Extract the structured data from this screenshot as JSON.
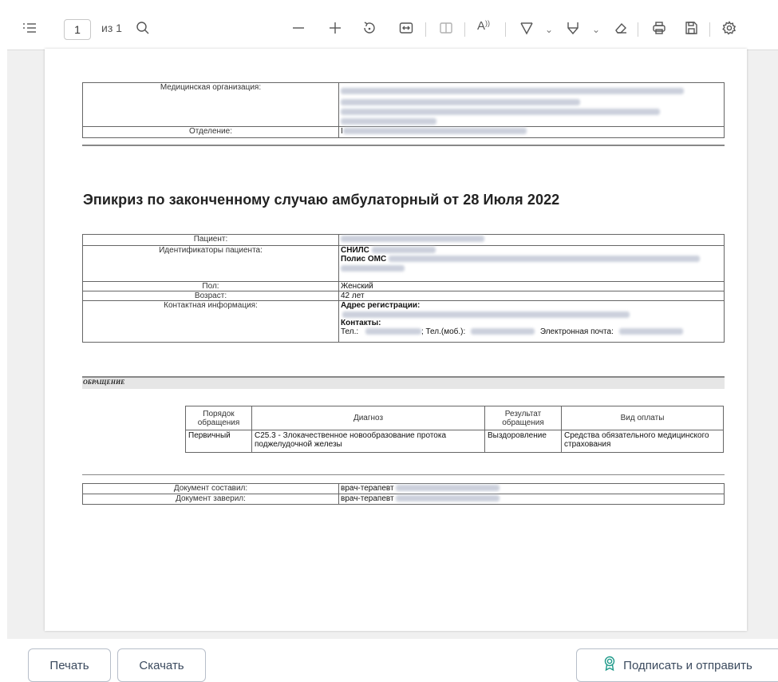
{
  "toolbar": {
    "page_value": "1",
    "page_of": "из 1",
    "icons": [
      "toc-icon",
      "search-icon",
      "zoom-out-icon",
      "zoom-in-icon",
      "rotate-icon",
      "fit-width-icon",
      "two-page-icon",
      "read-aloud-icon",
      "draw-icon",
      "highlight-icon",
      "eraser-icon",
      "print-icon",
      "save-icon",
      "settings-icon"
    ]
  },
  "document": {
    "header": {
      "org_label": "Медицинская организация:",
      "dept_label": "Отделение:",
      "dept_value": "I"
    },
    "title": "Эпикриз по законченному случаю амбулаторный от 28 Июля 2022",
    "patient": {
      "patient_label": "Пациент:",
      "ids_label": "Идентификаторы пациента:",
      "snils_label": "СНИЛС",
      "oms_label": "Полис ОМС",
      "sex_label": "Пол:",
      "sex_value": "Женский",
      "age_label": "Возраст:",
      "age_value": "42 лет",
      "contact_label": "Контактная информация:",
      "address_label": "Адрес регистрации:",
      "contacts_label": "Контакты:",
      "tel_label": "Тел.:",
      "mob_label": "; Тел.(моб.):",
      "email_label": "Электронная почта:"
    },
    "section_title": "ОБРАЩЕНИЕ",
    "visit": {
      "headers": [
        "Порядок обращения",
        "Диагноз",
        "Результат обращения",
        "Вид оплаты"
      ],
      "row": [
        "Первичный",
        "C25.3 - Злокачественное новообразование протока поджелудочной железы",
        "Выздоровление",
        "Средства обязательного медицинского страхования"
      ]
    },
    "signers": {
      "composed_label": "Документ составил:",
      "composed_value": "врач-терапевт",
      "certified_label": "Документ заверил:",
      "certified_value": "врач-терапевт"
    }
  },
  "buttons": {
    "print": "Печать",
    "download": "Скачать",
    "sign_send": "Подписать и отправить"
  },
  "colors": {
    "accent": "#1f9a8a",
    "button_text": "#3b4a5e",
    "button_border": "#b7bec9"
  }
}
